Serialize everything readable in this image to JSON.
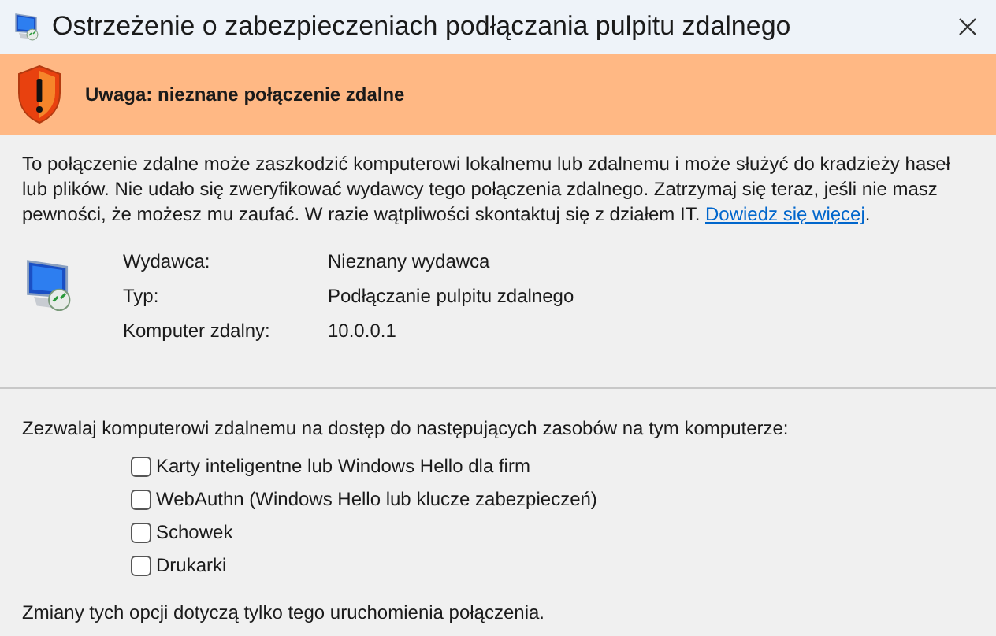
{
  "window": {
    "title": "Ostrzeżenie o zabezpieczeniach podłączania pulpitu zdalnego"
  },
  "banner": {
    "text": "Uwaga: nieznane połączenie zdalne"
  },
  "description": {
    "text": "To połączenie zdalne może zaszkodzić komputerowi lokalnemu lub zdalnemu i może służyć do kradzieży haseł lub plików. Nie udało się zweryfikować wydawcy tego połączenia zdalnego. Zatrzymaj się teraz, jeśli nie masz pewności, że możesz mu zaufać. W razie wątpliwości skontaktuj się z działem IT.",
    "link": "Dowiedz się więcej",
    "tail": "."
  },
  "details": [
    {
      "label": "Wydawca:",
      "value": "Nieznany wydawca"
    },
    {
      "label": "Typ:",
      "value": "Podłączanie pulpitu zdalnego"
    },
    {
      "label": "Komputer zdalny:",
      "value": "10.0.0.1"
    }
  ],
  "resources": {
    "prompt": "Zezwalaj komputerowi zdalnemu na dostęp do następujących zasobów na tym komputerze:",
    "options": [
      {
        "label": "Karty inteligentne lub Windows Hello dla firm",
        "checked": false
      },
      {
        "label": "WebAuthn (Windows Hello lub klucze zabezpieczeń)",
        "checked": false
      },
      {
        "label": "Schowek",
        "checked": false
      },
      {
        "label": "Drukarki",
        "checked": false
      }
    ],
    "note": "Zmiany tych opcji dotyczą tylko tego uruchomienia połączenia."
  }
}
